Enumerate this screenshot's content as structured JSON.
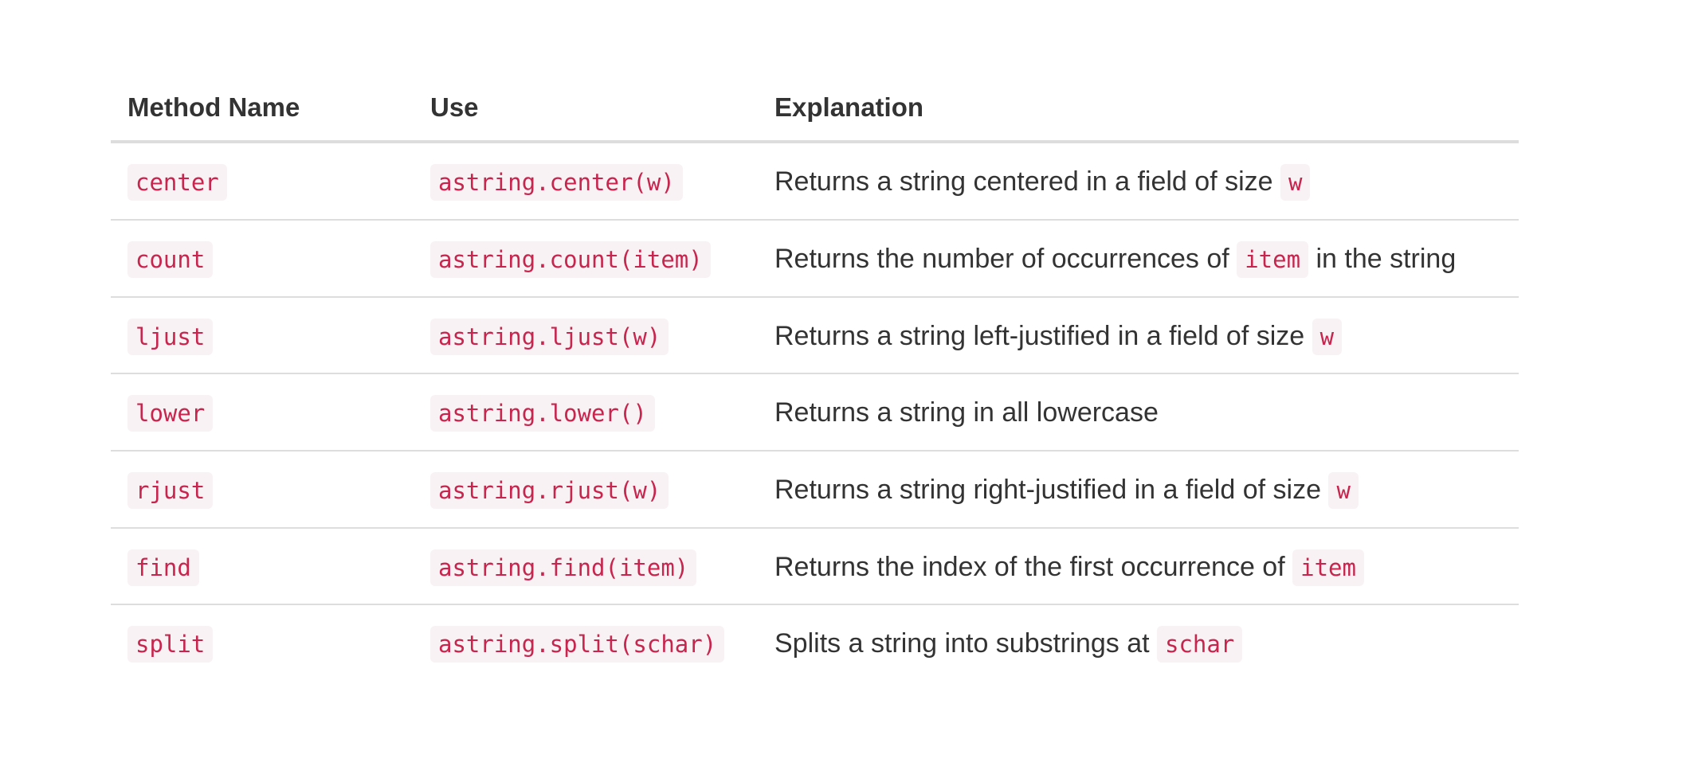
{
  "table": {
    "headers": [
      "Method Name",
      "Use",
      "Explanation"
    ],
    "rows": [
      {
        "method": "center",
        "use": "astring.center(w)",
        "explanation_pre": "Returns a string centered in a field of size ",
        "explanation_code": "w",
        "explanation_post": ""
      },
      {
        "method": "count",
        "use": "astring.count(item)",
        "explanation_pre": "Returns the number of occurrences of ",
        "explanation_code": "item",
        "explanation_post": " in the string"
      },
      {
        "method": "ljust",
        "use": "astring.ljust(w)",
        "explanation_pre": "Returns a string left-justified in a field of size ",
        "explanation_code": "w",
        "explanation_post": ""
      },
      {
        "method": "lower",
        "use": "astring.lower()",
        "explanation_pre": "Returns a string in all lowercase",
        "explanation_code": "",
        "explanation_post": ""
      },
      {
        "method": "rjust",
        "use": "astring.rjust(w)",
        "explanation_pre": "Returns a string right-justified in a field of size ",
        "explanation_code": "w",
        "explanation_post": ""
      },
      {
        "method": "find",
        "use": "astring.find(item)",
        "explanation_pre": "Returns the index of the first occurrence of ",
        "explanation_code": "item",
        "explanation_post": ""
      },
      {
        "method": "split",
        "use": "astring.split(schar)",
        "explanation_pre": "Splits a string into substrings at ",
        "explanation_code": "schar",
        "explanation_post": ""
      }
    ]
  }
}
